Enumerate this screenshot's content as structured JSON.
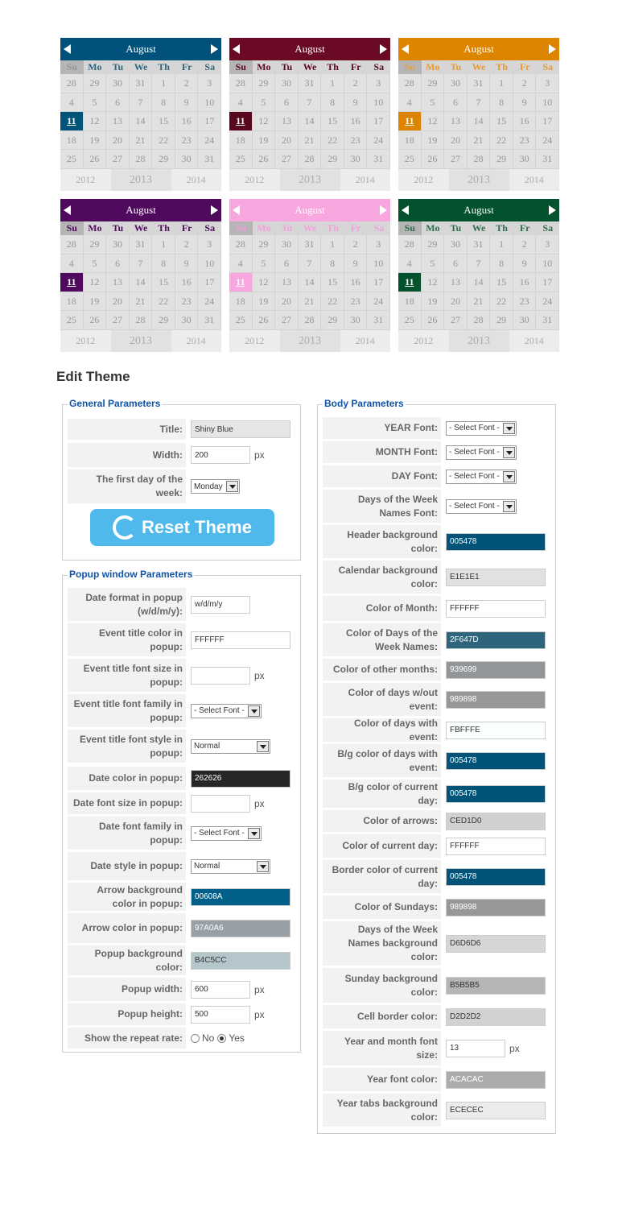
{
  "calendars": [
    {
      "month": "August",
      "header_color": "#00527a",
      "accent": "#005478",
      "days_color": "#2f647d",
      "sun_color": "#979797"
    },
    {
      "month": "August",
      "header_color": "#6a0a25",
      "accent": "#5a0820",
      "days_color": "#5a0820",
      "sun_color": "#5a0820"
    },
    {
      "month": "August",
      "header_color": "#dd8400",
      "accent": "#dd8400",
      "days_color": "#e89a2f",
      "sun_color": "#e0a050"
    },
    {
      "month": "August",
      "header_color": "#4f0a5e",
      "accent": "#4f0a5e",
      "days_color": "#4f0a5e",
      "sun_color": "#4f0a5e"
    },
    {
      "month": "August",
      "header_color": "#f7a6de",
      "accent": "#f7a6de",
      "days_color": "#f3a0dc",
      "sun_color": "#f3a0dc"
    },
    {
      "month": "August",
      "header_color": "#04512e",
      "accent": "#04512e",
      "days_color": "#2f6c4d",
      "sun_color": "#2f6c4d"
    }
  ],
  "weekdays": [
    "Su",
    "Mo",
    "Tu",
    "We",
    "Th",
    "Fr",
    "Sa"
  ],
  "weeks": [
    [
      "28",
      "29",
      "30",
      "31",
      "1",
      "2",
      "3"
    ],
    [
      "4",
      "5",
      "6",
      "7",
      "8",
      "9",
      "10"
    ],
    [
      "11",
      "12",
      "13",
      "14",
      "15",
      "16",
      "17"
    ],
    [
      "18",
      "19",
      "20",
      "21",
      "22",
      "23",
      "24"
    ],
    [
      "25",
      "26",
      "27",
      "28",
      "29",
      "30",
      "31"
    ]
  ],
  "years": [
    "2012",
    "2013",
    "2014"
  ],
  "page_title": "Edit Theme",
  "general": {
    "legend": "General Parameters",
    "title_label": "Title:",
    "title_value": "Shiny Blue",
    "width_label": "Width:",
    "width_value": "200",
    "width_unit": "px",
    "firstday_label": "The first day of the week:",
    "firstday_value": "Monday",
    "reset_label": "Reset Theme"
  },
  "popup": {
    "legend": "Popup window Parameters",
    "rows": [
      {
        "label": "Date format in popup (w/d/m/y):",
        "type": "input",
        "value": "w/d/m/y",
        "w": 74
      },
      {
        "label": "Event title color in popup:",
        "type": "input",
        "value": "FFFFFF",
        "w": 124
      },
      {
        "label": "Event title font size in popup:",
        "type": "input",
        "value": "",
        "w": 74,
        "unit": "px"
      },
      {
        "label": "Event title font family in popup:",
        "type": "select",
        "value": "- Select Font -"
      },
      {
        "label": "Event title font style in popup:",
        "type": "select",
        "value": "Normal"
      },
      {
        "label": "Date color in popup:",
        "type": "color",
        "value": "262626",
        "color": "#262626",
        "text": "#fff"
      },
      {
        "label": "Date font size in popup:",
        "type": "input",
        "value": "",
        "w": 74,
        "unit": "px"
      },
      {
        "label": "Date font family in popup:",
        "type": "select",
        "value": "- Select Font -"
      },
      {
        "label": "Date style in popup:",
        "type": "select",
        "value": "Normal"
      },
      {
        "label": "Arrow background color in popup:",
        "type": "color",
        "value": "00608A",
        "color": "#00608a",
        "text": "#fff"
      },
      {
        "label": "Arrow color in popup:",
        "type": "color",
        "value": "97A0A6",
        "color": "#97a0a6",
        "text": "#fff"
      },
      {
        "label": "Popup background color:",
        "type": "color",
        "value": "B4C5CC",
        "color": "#b4c5cc",
        "text": "#333"
      },
      {
        "label": "Popup width:",
        "type": "input",
        "value": "600",
        "w": 74,
        "unit": "px"
      },
      {
        "label": "Popup height:",
        "type": "input",
        "value": "500",
        "w": 74,
        "unit": "px"
      },
      {
        "label": "Show the repeat rate:",
        "type": "radio",
        "no": "No",
        "yes": "Yes"
      }
    ]
  },
  "body": {
    "legend": "Body Parameters",
    "rows": [
      {
        "label": "YEAR Font:",
        "type": "select",
        "value": "- Select Font -"
      },
      {
        "label": "MONTH Font:",
        "type": "select",
        "value": "- Select Font -"
      },
      {
        "label": "DAY Font:",
        "type": "select",
        "value": "- Select Font -"
      },
      {
        "label": "Days of the Week Names Font:",
        "type": "select",
        "value": "- Select Font -"
      },
      {
        "label": "Header background color:",
        "type": "color",
        "value": "005478",
        "color": "#005478",
        "text": "#fff"
      },
      {
        "label": "Calendar background color:",
        "type": "color",
        "value": "E1E1E1",
        "color": "#e1e1e1",
        "text": "#333"
      },
      {
        "label": "Color of Month:",
        "type": "color",
        "value": "FFFFFF",
        "color": "#ffffff",
        "text": "#333"
      },
      {
        "label": "Color of Days of the Week Names:",
        "type": "color",
        "value": "2F647D",
        "color": "#2f647d",
        "text": "#fff"
      },
      {
        "label": "Color of other months:",
        "type": "color",
        "value": "939699",
        "color": "#939699",
        "text": "#fff"
      },
      {
        "label": "Color of days w/out event:",
        "type": "color",
        "value": "989898",
        "color": "#989898",
        "text": "#fff"
      },
      {
        "label": "Color of days with event:",
        "type": "color",
        "value": "FBFFFE",
        "color": "#fbfffe",
        "text": "#333"
      },
      {
        "label": "B/g color of days with event:",
        "type": "color",
        "value": "005478",
        "color": "#005478",
        "text": "#fff"
      },
      {
        "label": "B/g color of current day:",
        "type": "color",
        "value": "005478",
        "color": "#005478",
        "text": "#fff"
      },
      {
        "label": "Color of arrows:",
        "type": "color",
        "value": "CED1D0",
        "color": "#ced1d0",
        "text": "#333"
      },
      {
        "label": "Color of current day:",
        "type": "color",
        "value": "FFFFFF",
        "color": "#ffffff",
        "text": "#333"
      },
      {
        "label": "Border color of current day:",
        "type": "color",
        "value": "005478",
        "color": "#005478",
        "text": "#fff"
      },
      {
        "label": "Color of Sundays:",
        "type": "color",
        "value": "989898",
        "color": "#989898",
        "text": "#fff"
      },
      {
        "label": "Days of the Week Names background color:",
        "type": "color",
        "value": "D6D6D6",
        "color": "#d6d6d6",
        "text": "#333"
      },
      {
        "label": "Sunday background color:",
        "type": "color",
        "value": "B5B5B5",
        "color": "#b5b5b5",
        "text": "#333"
      },
      {
        "label": "Cell border color:",
        "type": "color",
        "value": "D2D2D2",
        "color": "#d2d2d2",
        "text": "#333"
      },
      {
        "label": "Year and month font size:",
        "type": "input",
        "value": "13",
        "w": 74,
        "unit": "px"
      },
      {
        "label": "Year font color:",
        "type": "color",
        "value": "ACACAC",
        "color": "#acacac",
        "text": "#fff"
      },
      {
        "label": "Year tabs background color:",
        "type": "color",
        "value": "ECECEC",
        "color": "#ececec",
        "text": "#333"
      }
    ]
  }
}
